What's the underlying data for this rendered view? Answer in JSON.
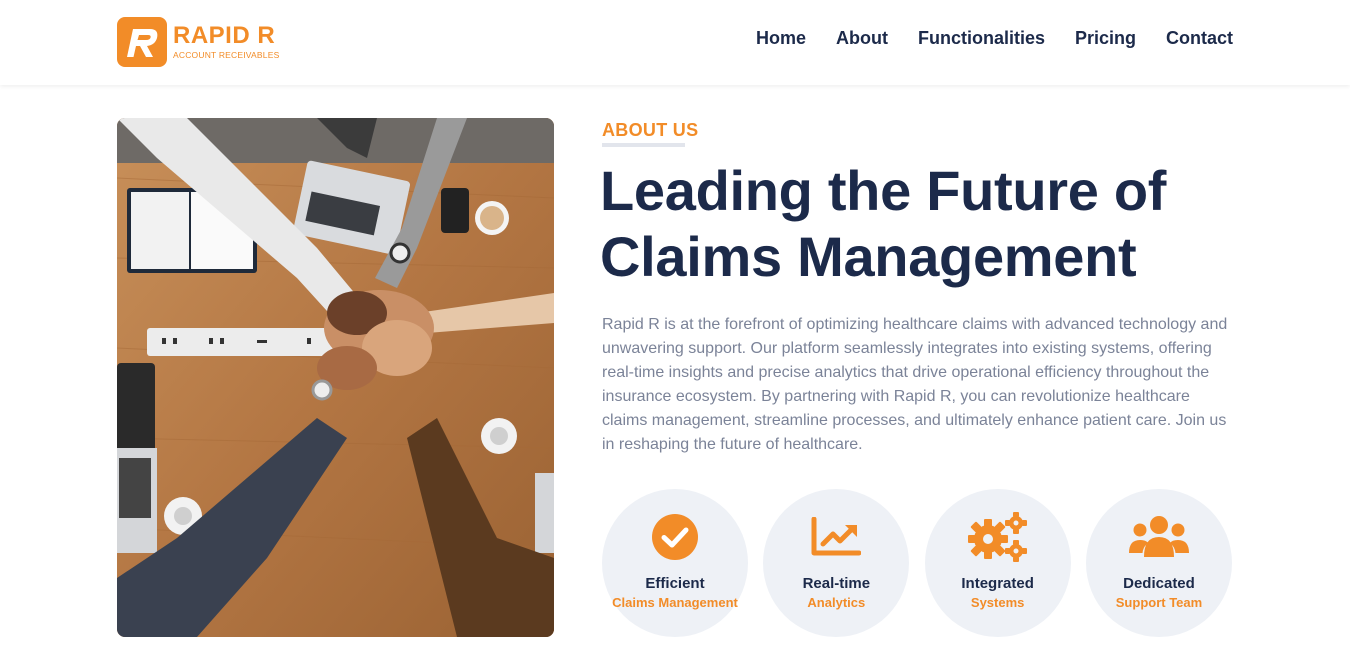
{
  "brand": {
    "name": "RAPID R",
    "tagline": "ACCOUNT RECEIVABLES",
    "mark_letter": "R",
    "accent_color": "#f28c28",
    "navy_color": "#1c2a4a"
  },
  "nav": {
    "items": [
      {
        "label": "Home"
      },
      {
        "label": "About"
      },
      {
        "label": "Functionalities"
      },
      {
        "label": "Pricing"
      },
      {
        "label": "Contact"
      }
    ]
  },
  "about": {
    "eyebrow": "ABOUT US",
    "headline_line1": "Leading the Future of",
    "headline_line2": "Claims Management",
    "description": "Rapid R is at the forefront of optimizing healthcare claims with advanced technology and unwavering support. Our platform seamlessly integrates into existing systems, offering real-time insights and precise analytics that drive operational efficiency throughout the insurance ecosystem. By partnering with Rapid R, you can revolutionize healthcare claims management, streamline processes, and ultimately enhance patient care. Join us in reshaping the future of healthcare.",
    "photo_icon": "team-hands-photo"
  },
  "features": [
    {
      "icon": "check-circle-icon",
      "title": "Efficient",
      "subtitle": "Claims Management"
    },
    {
      "icon": "chart-line-icon",
      "title": "Real-time",
      "subtitle": "Analytics"
    },
    {
      "icon": "gears-icon",
      "title": "Integrated",
      "subtitle": "Systems"
    },
    {
      "icon": "users-icon",
      "title": "Dedicated",
      "subtitle": "Support Team"
    }
  ]
}
